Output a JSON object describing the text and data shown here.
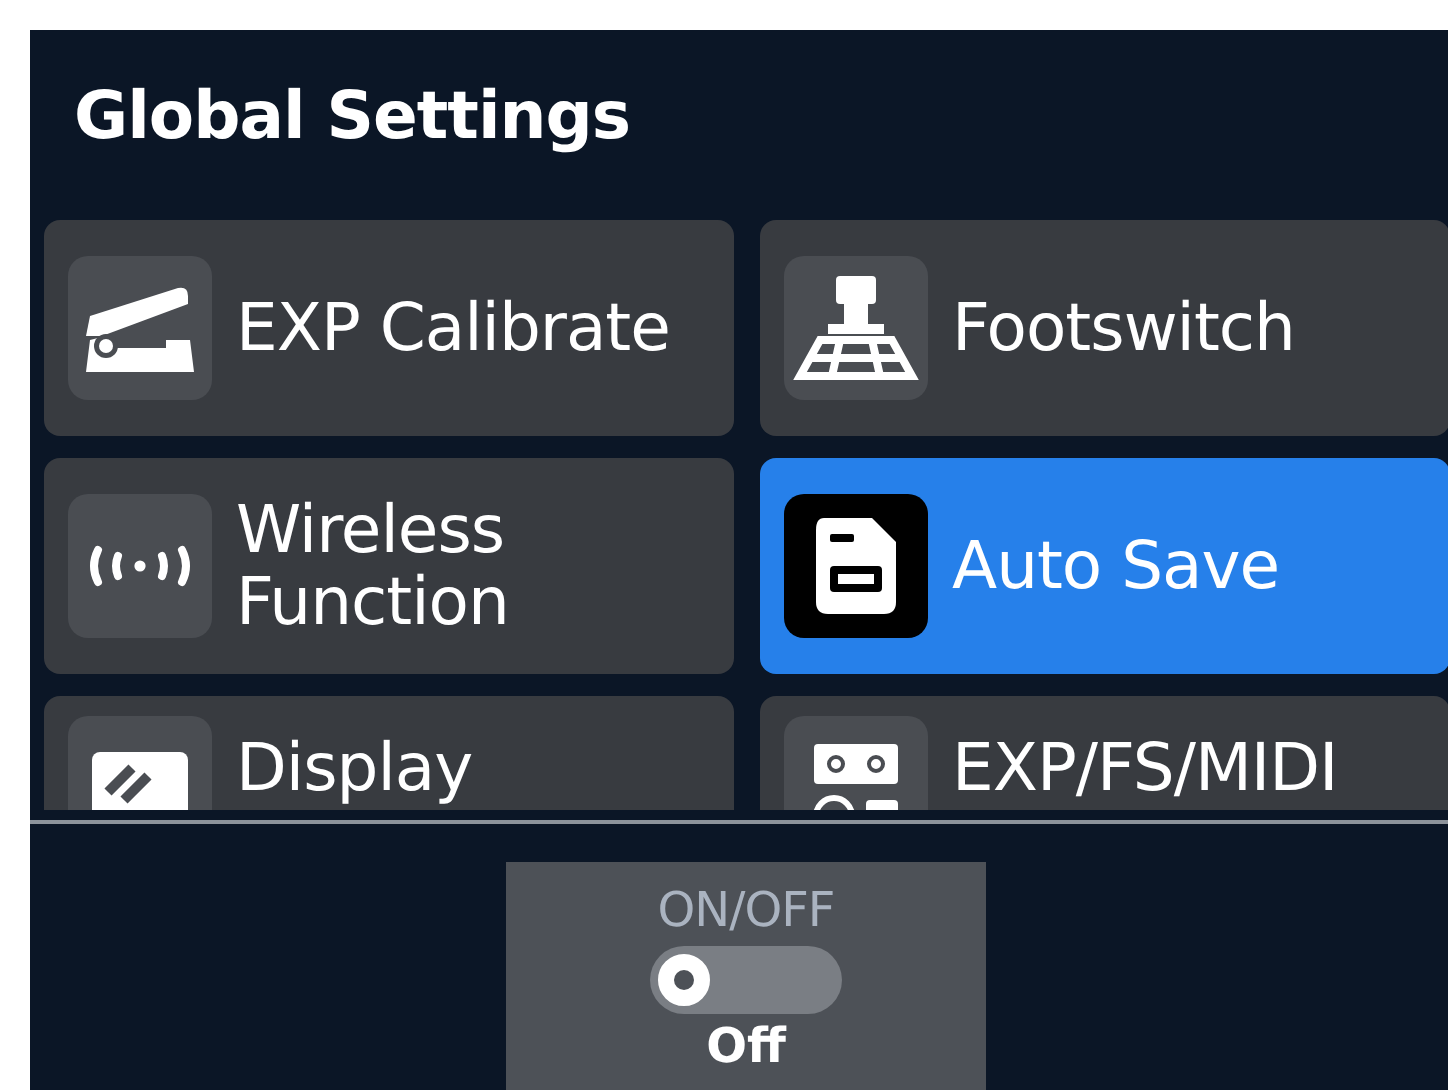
{
  "header": {
    "title": "Global Settings"
  },
  "tiles": [
    {
      "label": "EXP Calibrate",
      "kind": "pedal",
      "selected": false
    },
    {
      "label": "Footswitch",
      "kind": "footswitch",
      "selected": false
    },
    {
      "label": "Wireless Function",
      "kind": "wireless",
      "selected": false
    },
    {
      "label": "Auto Save",
      "kind": "save",
      "selected": true
    },
    {
      "label": "Display",
      "kind": "display",
      "selected": false
    },
    {
      "label": "EXP/FS/MIDI",
      "kind": "ports",
      "selected": false
    }
  ],
  "control": {
    "label": "ON/OFF",
    "on": false,
    "value": "Off"
  }
}
